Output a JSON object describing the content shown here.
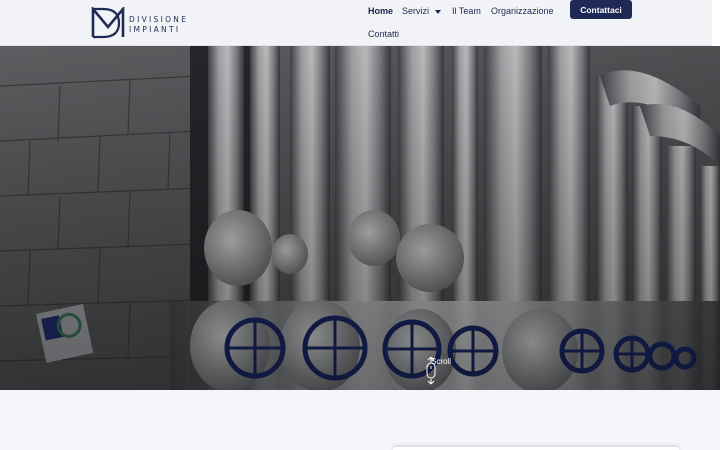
{
  "brand": {
    "logo_alt": "DM Divisione Impianti",
    "line1": "DIVISIONE",
    "line2": "IMPIANTI",
    "color": "#1f2a55"
  },
  "nav": {
    "items": [
      {
        "label": "Home",
        "active": true
      },
      {
        "label": "Servizi",
        "has_dropdown": true
      },
      {
        "label": "Il Team"
      },
      {
        "label": "Organizzazione"
      },
      {
        "label": "Contatti"
      }
    ],
    "cta_label": "Contattaci"
  },
  "hero": {
    "scroll_label": "Scroll",
    "image_subject": "industrial stainless steel pipes with blue gate valves"
  },
  "colors": {
    "header_bg": "#f2f3f6",
    "accent": "#1e2a55",
    "page_bg": "#f4f6fb",
    "valve": "#1c2a6e"
  }
}
